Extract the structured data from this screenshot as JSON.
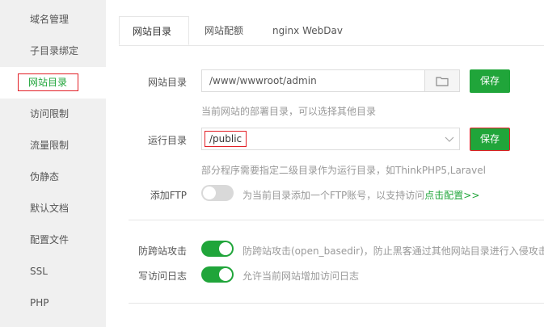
{
  "sidebar": {
    "items": [
      {
        "label": "域名管理"
      },
      {
        "label": "子目录绑定"
      },
      {
        "label": "网站目录",
        "active": true
      },
      {
        "label": "访问限制"
      },
      {
        "label": "流量限制"
      },
      {
        "label": "伪静态"
      },
      {
        "label": "默认文档"
      },
      {
        "label": "配置文件"
      },
      {
        "label": "SSL"
      },
      {
        "label": "PHP"
      }
    ]
  },
  "tabs": [
    {
      "label": "网站目录",
      "active": true
    },
    {
      "label": "网站配额"
    },
    {
      "label": "nginx WebDav"
    }
  ],
  "form": {
    "site_dir": {
      "label": "网站目录",
      "value": "/www/wwwroot/admin",
      "save_label": "保存",
      "help": "当前网站的部署目录，可以选择其他目录"
    },
    "run_dir": {
      "label": "运行目录",
      "value": "/public",
      "save_label": "保存",
      "help": "部分程序需要指定二级目录作为运行目录，如ThinkPHP5,Laravel"
    },
    "ftp": {
      "label": "添加FTP",
      "enabled": false,
      "help": "为当前目录添加一个FTP账号，以支持访问",
      "link": "点击配置>>"
    },
    "anti_cross": {
      "label": "防跨站攻击",
      "enabled": true,
      "help": "防跨站攻击(open_basedir)，防止黑客通过其他网站目录进行入侵攻击"
    },
    "access_log": {
      "label": "写访问日志",
      "enabled": true,
      "help": "允许当前网站增加访问日志"
    }
  },
  "colors": {
    "accent": "#20a53a",
    "highlight_border": "#e21f26"
  },
  "icons": {
    "folder": "folder-icon",
    "dropdown": "chevron-down-icon"
  }
}
